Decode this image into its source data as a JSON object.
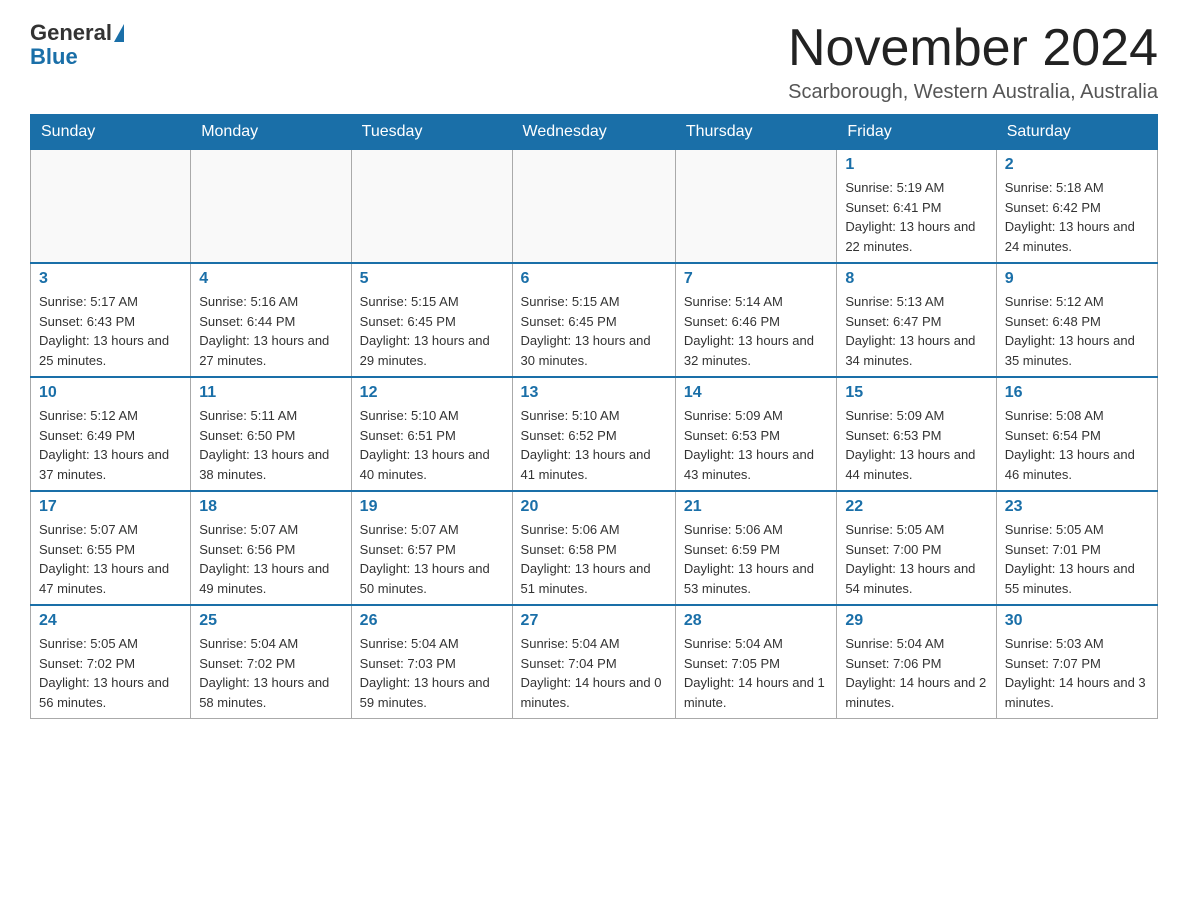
{
  "logo": {
    "general": "General",
    "blue": "Blue"
  },
  "title": "November 2024",
  "subtitle": "Scarborough, Western Australia, Australia",
  "days_of_week": [
    "Sunday",
    "Monday",
    "Tuesday",
    "Wednesday",
    "Thursday",
    "Friday",
    "Saturday"
  ],
  "weeks": [
    [
      {
        "day": "",
        "info": ""
      },
      {
        "day": "",
        "info": ""
      },
      {
        "day": "",
        "info": ""
      },
      {
        "day": "",
        "info": ""
      },
      {
        "day": "",
        "info": ""
      },
      {
        "day": "1",
        "info": "Sunrise: 5:19 AM\nSunset: 6:41 PM\nDaylight: 13 hours and 22 minutes."
      },
      {
        "day": "2",
        "info": "Sunrise: 5:18 AM\nSunset: 6:42 PM\nDaylight: 13 hours and 24 minutes."
      }
    ],
    [
      {
        "day": "3",
        "info": "Sunrise: 5:17 AM\nSunset: 6:43 PM\nDaylight: 13 hours and 25 minutes."
      },
      {
        "day": "4",
        "info": "Sunrise: 5:16 AM\nSunset: 6:44 PM\nDaylight: 13 hours and 27 minutes."
      },
      {
        "day": "5",
        "info": "Sunrise: 5:15 AM\nSunset: 6:45 PM\nDaylight: 13 hours and 29 minutes."
      },
      {
        "day": "6",
        "info": "Sunrise: 5:15 AM\nSunset: 6:45 PM\nDaylight: 13 hours and 30 minutes."
      },
      {
        "day": "7",
        "info": "Sunrise: 5:14 AM\nSunset: 6:46 PM\nDaylight: 13 hours and 32 minutes."
      },
      {
        "day": "8",
        "info": "Sunrise: 5:13 AM\nSunset: 6:47 PM\nDaylight: 13 hours and 34 minutes."
      },
      {
        "day": "9",
        "info": "Sunrise: 5:12 AM\nSunset: 6:48 PM\nDaylight: 13 hours and 35 minutes."
      }
    ],
    [
      {
        "day": "10",
        "info": "Sunrise: 5:12 AM\nSunset: 6:49 PM\nDaylight: 13 hours and 37 minutes."
      },
      {
        "day": "11",
        "info": "Sunrise: 5:11 AM\nSunset: 6:50 PM\nDaylight: 13 hours and 38 minutes."
      },
      {
        "day": "12",
        "info": "Sunrise: 5:10 AM\nSunset: 6:51 PM\nDaylight: 13 hours and 40 minutes."
      },
      {
        "day": "13",
        "info": "Sunrise: 5:10 AM\nSunset: 6:52 PM\nDaylight: 13 hours and 41 minutes."
      },
      {
        "day": "14",
        "info": "Sunrise: 5:09 AM\nSunset: 6:53 PM\nDaylight: 13 hours and 43 minutes."
      },
      {
        "day": "15",
        "info": "Sunrise: 5:09 AM\nSunset: 6:53 PM\nDaylight: 13 hours and 44 minutes."
      },
      {
        "day": "16",
        "info": "Sunrise: 5:08 AM\nSunset: 6:54 PM\nDaylight: 13 hours and 46 minutes."
      }
    ],
    [
      {
        "day": "17",
        "info": "Sunrise: 5:07 AM\nSunset: 6:55 PM\nDaylight: 13 hours and 47 minutes."
      },
      {
        "day": "18",
        "info": "Sunrise: 5:07 AM\nSunset: 6:56 PM\nDaylight: 13 hours and 49 minutes."
      },
      {
        "day": "19",
        "info": "Sunrise: 5:07 AM\nSunset: 6:57 PM\nDaylight: 13 hours and 50 minutes."
      },
      {
        "day": "20",
        "info": "Sunrise: 5:06 AM\nSunset: 6:58 PM\nDaylight: 13 hours and 51 minutes."
      },
      {
        "day": "21",
        "info": "Sunrise: 5:06 AM\nSunset: 6:59 PM\nDaylight: 13 hours and 53 minutes."
      },
      {
        "day": "22",
        "info": "Sunrise: 5:05 AM\nSunset: 7:00 PM\nDaylight: 13 hours and 54 minutes."
      },
      {
        "day": "23",
        "info": "Sunrise: 5:05 AM\nSunset: 7:01 PM\nDaylight: 13 hours and 55 minutes."
      }
    ],
    [
      {
        "day": "24",
        "info": "Sunrise: 5:05 AM\nSunset: 7:02 PM\nDaylight: 13 hours and 56 minutes."
      },
      {
        "day": "25",
        "info": "Sunrise: 5:04 AM\nSunset: 7:02 PM\nDaylight: 13 hours and 58 minutes."
      },
      {
        "day": "26",
        "info": "Sunrise: 5:04 AM\nSunset: 7:03 PM\nDaylight: 13 hours and 59 minutes."
      },
      {
        "day": "27",
        "info": "Sunrise: 5:04 AM\nSunset: 7:04 PM\nDaylight: 14 hours and 0 minutes."
      },
      {
        "day": "28",
        "info": "Sunrise: 5:04 AM\nSunset: 7:05 PM\nDaylight: 14 hours and 1 minute."
      },
      {
        "day": "29",
        "info": "Sunrise: 5:04 AM\nSunset: 7:06 PM\nDaylight: 14 hours and 2 minutes."
      },
      {
        "day": "30",
        "info": "Sunrise: 5:03 AM\nSunset: 7:07 PM\nDaylight: 14 hours and 3 minutes."
      }
    ]
  ]
}
